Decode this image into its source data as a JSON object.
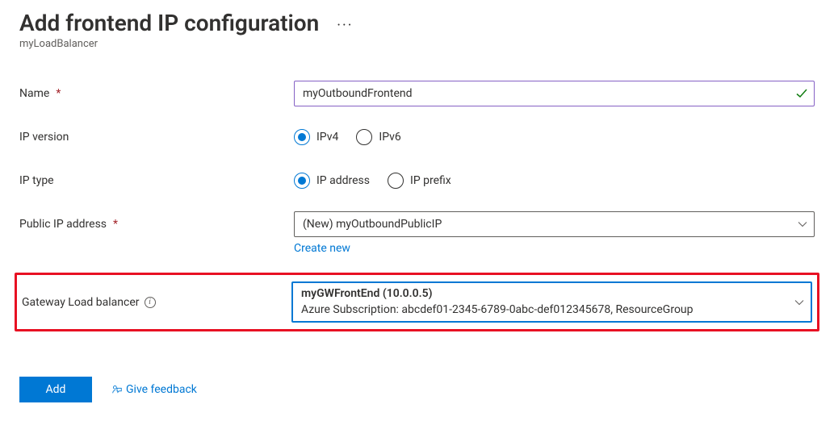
{
  "header": {
    "title": "Add frontend IP configuration",
    "subtitle": "myLoadBalancer"
  },
  "form": {
    "name": {
      "label": "Name",
      "value": "myOutboundFrontend"
    },
    "ip_version": {
      "label": "IP version",
      "options": {
        "ipv4": "IPv4",
        "ipv6": "IPv6"
      },
      "selected": "ipv4"
    },
    "ip_type": {
      "label": "IP type",
      "options": {
        "address": "IP address",
        "prefix": "IP prefix"
      },
      "selected": "address"
    },
    "public_ip": {
      "label": "Public IP address",
      "value": "(New) myOutboundPublicIP",
      "create_link": "Create new"
    },
    "gateway_lb": {
      "label": "Gateway Load balancer",
      "value_name": "myGWFrontEnd (10.0.0.5)",
      "value_detail": "Azure Subscription: abcdef01-2345-6789-0abc-def012345678, ResourceGroup"
    }
  },
  "footer": {
    "add_button": "Add",
    "feedback": "Give feedback"
  }
}
